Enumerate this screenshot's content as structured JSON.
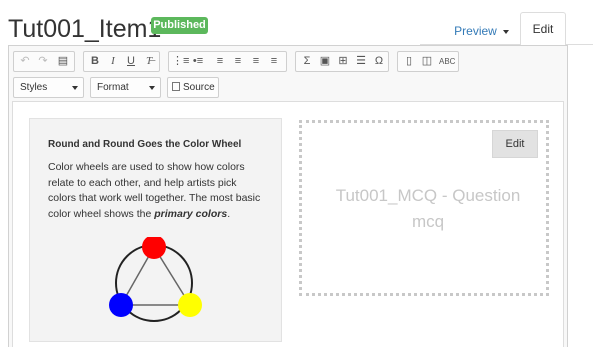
{
  "header": {
    "title": "Tut001_Item1",
    "status_badge": "Published",
    "tabs": [
      {
        "label": "Preview"
      },
      {
        "label": "Edit"
      }
    ]
  },
  "toolbar": {
    "styles_label": "Styles",
    "format_label": "Format",
    "source_label": "Source"
  },
  "content": {
    "card": {
      "heading": "Round and Round Goes the Color Wheel",
      "body_text": "Color wheels are used to show how colors relate to each other, and help artists pick colors that work well together. The most basic color wheel shows the ",
      "body_emphasis": "primary colors",
      "body_end": ".",
      "wheel_colors": {
        "top": "#ff0000",
        "left": "#0000ff",
        "right": "#ffff00"
      }
    },
    "question_box": {
      "edit_label": "Edit",
      "placeholder_text": "Tut001_MCQ - Question mcq"
    }
  },
  "colors": {
    "badge_green": "#5cb85c",
    "link_blue": "#337ab7"
  }
}
